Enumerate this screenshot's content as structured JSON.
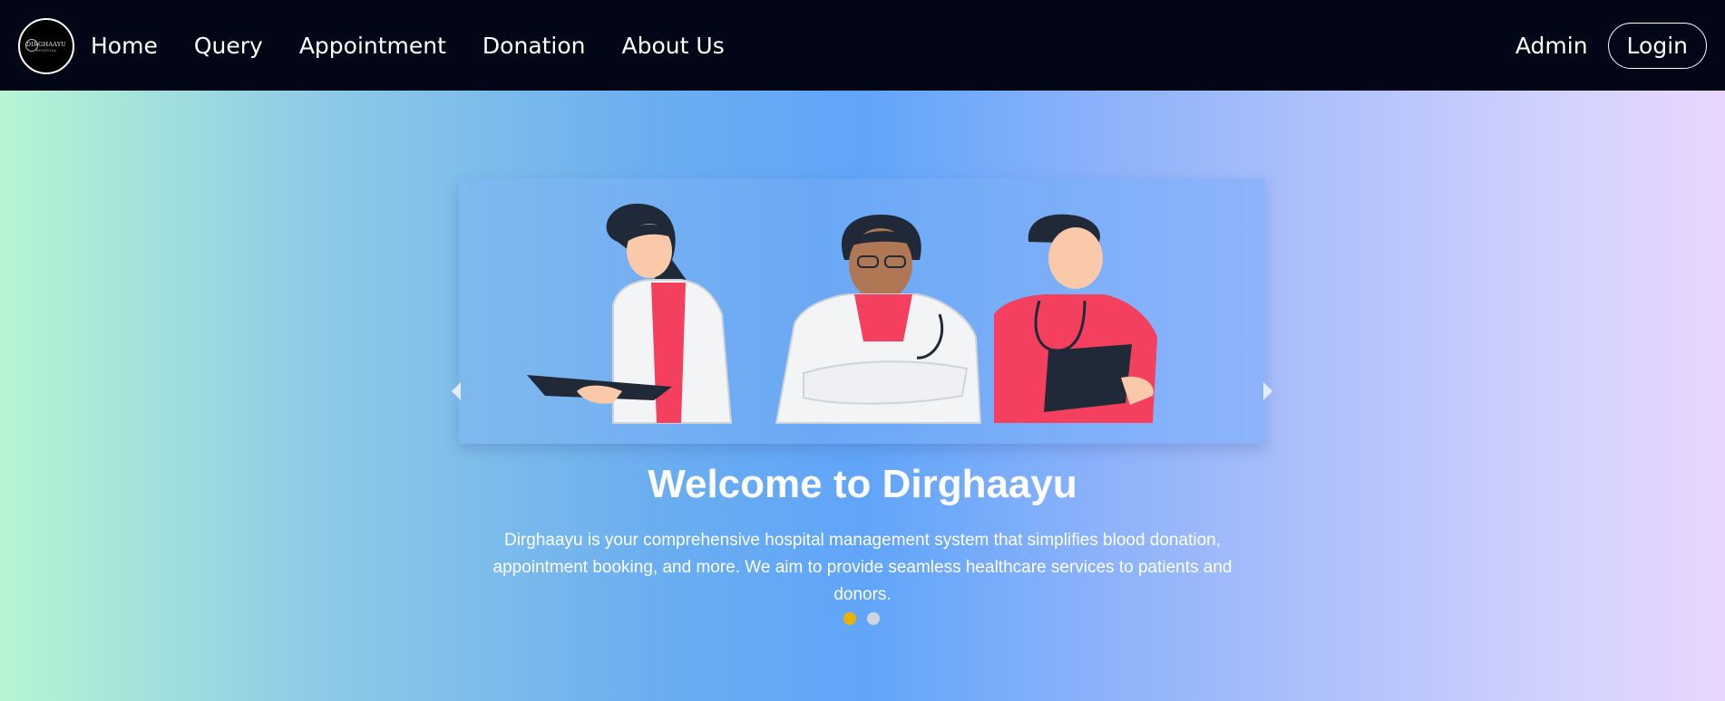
{
  "nav": {
    "logo_text": "DIRGHAAYU",
    "logo_subtext": "HOSPITAL",
    "links": [
      "Home",
      "Query",
      "Appointment",
      "Donation",
      "About Us"
    ],
    "admin_label": "Admin",
    "login_label": "Login"
  },
  "hero": {
    "slide": {
      "illustration": "three-doctors-illustration"
    },
    "title": "Welcome to Dirghaayu",
    "description": "Dirghaayu is your comprehensive hospital management system that simplifies blood donation, appointment booking, and more. We aim to provide seamless healthcare services to patients and donors.",
    "slide_count": 2,
    "active_slide": 1,
    "prev_icon": "chevron-left-icon",
    "next_icon": "chevron-right-icon"
  },
  "colors": {
    "navbar_bg": "#020617",
    "dot_active": "#eab308",
    "dot_inactive": "#d1d5db",
    "gradient_start": "#b7f5d3",
    "gradient_mid": "#60a5fa",
    "gradient_end": "#e9d5ff"
  }
}
